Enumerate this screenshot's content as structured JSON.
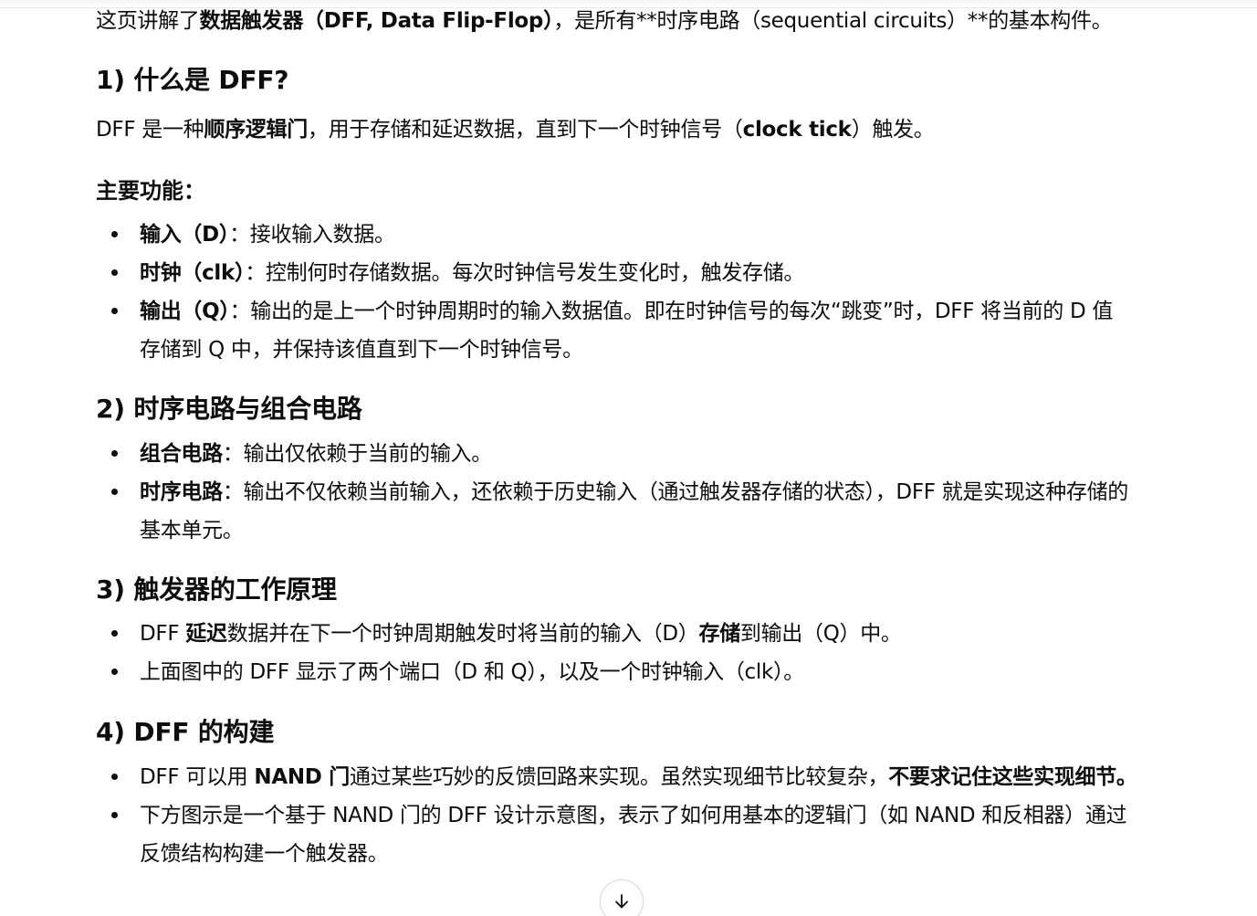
{
  "intro": {
    "t1": "这页讲解了",
    "b1": "数据触发器（DFF, Data Flip-Flop）",
    "t2": "，是所有**时序电路（sequential circuits）**的基本构件。"
  },
  "sections": {
    "s1": {
      "heading": "1) 什么是 DFF?",
      "para": {
        "t1": "DFF 是一种",
        "b1": "顺序逻辑门",
        "t2": "，用于存储和延迟数据，直到下一个时钟信号（",
        "b2": "clock tick",
        "t3": "）触发。"
      },
      "subheading": "主要功能：",
      "items": [
        {
          "b": "输入（D）",
          "t": "：接收输入数据。"
        },
        {
          "b": "时钟（clk）",
          "t": "：控制何时存储数据。每次时钟信号发生变化时，触发存储。"
        },
        {
          "b": "输出（Q）",
          "t": "：输出的是上一个时钟周期时的输入数据值。即在时钟信号的每次“跳变”时，DFF 将当前的 D 值存储到 Q 中，并保持该值直到下一个时钟信号。"
        }
      ]
    },
    "s2": {
      "heading": "2) 时序电路与组合电路",
      "items": [
        {
          "b": "组合电路",
          "t": "：输出仅依赖于当前的输入。"
        },
        {
          "b": "时序电路",
          "t": "：输出不仅依赖当前输入，还依赖于历史输入（通过触发器存储的状态），DFF 就是实现这种存储的基本单元。"
        }
      ]
    },
    "s3": {
      "heading": "3) 触发器的工作原理",
      "items": [
        {
          "t1": "DFF ",
          "b1": "延迟",
          "t2": "数据并在下一个时钟周期触发时将当前的输入（D）",
          "b2": "存储",
          "t3": "到输出（Q）中。"
        },
        {
          "t1": "上面图中的 DFF 显示了两个端口（D 和 Q），以及一个时钟输入（clk）。"
        }
      ]
    },
    "s4": {
      "heading": "4) DFF 的构建",
      "items": [
        {
          "t1": "DFF 可以用 ",
          "b1": "NAND 门",
          "t2": "通过某些巧妙的反馈回路来实现。虽然实现细节比较复杂，",
          "b2": "不要求记住这些实现细节。"
        },
        {
          "t1": "下方图示是一个基于 NAND 门的 DFF 设计示意图，表示了如何用基本的逻辑门（如 NAND 和反相器）通过反馈结构构建一个触发器。"
        }
      ]
    }
  },
  "scroll_button": {
    "icon": "arrow-down-icon"
  }
}
